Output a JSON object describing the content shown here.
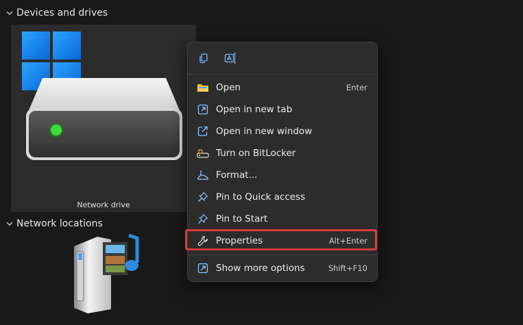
{
  "sections": {
    "devices": "Devices and drives",
    "network": "Network locations"
  },
  "drive": {
    "label": "Network drive"
  },
  "context_menu": {
    "quick_actions": [
      {
        "icon": "copy-icon"
      },
      {
        "icon": "rename-icon"
      }
    ],
    "items": [
      {
        "label": "Open",
        "shortcut": "Enter",
        "icon": "folder-icon"
      },
      {
        "label": "Open in new tab",
        "shortcut": "",
        "icon": "new-tab-icon"
      },
      {
        "label": "Open in new window",
        "shortcut": "",
        "icon": "new-window-icon"
      },
      {
        "label": "Turn on BitLocker",
        "shortcut": "",
        "icon": "bitlocker-icon"
      },
      {
        "label": "Format...",
        "shortcut": "",
        "icon": "format-icon"
      },
      {
        "label": "Pin to Quick access",
        "shortcut": "",
        "icon": "pin-icon"
      },
      {
        "label": "Pin to Start",
        "shortcut": "",
        "icon": "pin-icon"
      },
      {
        "label": "Properties",
        "shortcut": "Alt+Enter",
        "icon": "wrench-icon"
      },
      {
        "label": "Show more options",
        "shortcut": "Shift+F10",
        "icon": "more-options-icon"
      }
    ]
  },
  "colors": {
    "background": "#191919",
    "tile": "#2b2b2b",
    "menu": "#2c2c2c",
    "accent_blue": "#4aa3ff",
    "highlight_red": "#d83a3f",
    "led_green": "#3ddc3d"
  }
}
